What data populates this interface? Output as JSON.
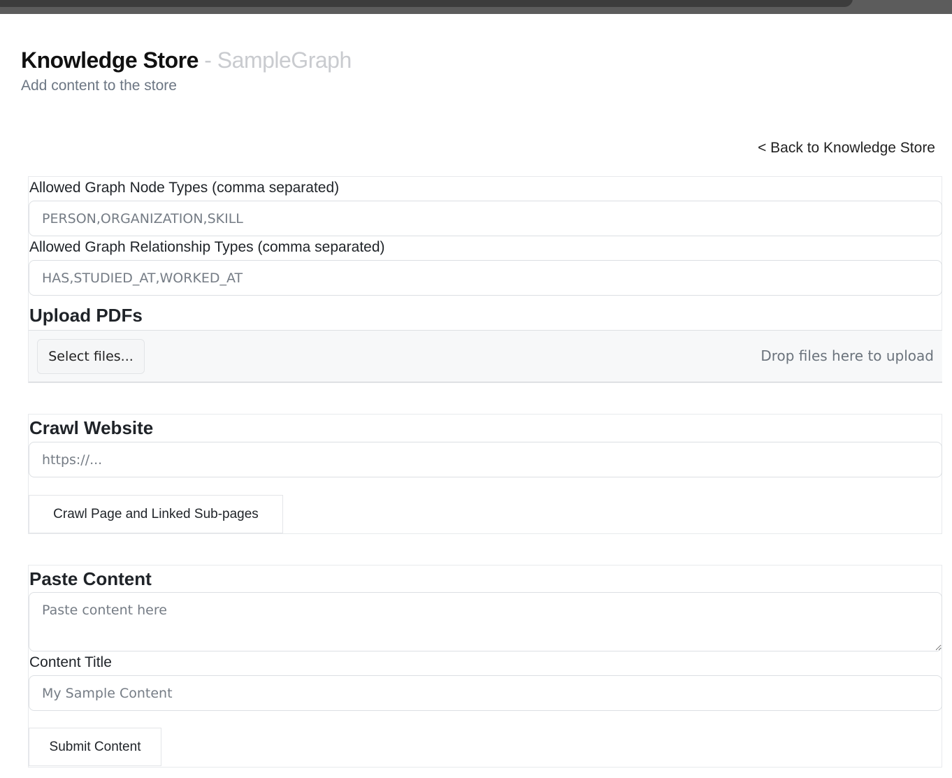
{
  "header": {
    "title": "Knowledge Store",
    "separator": "-",
    "graph_name": "SampleGraph",
    "subtitle": "Add content to the store"
  },
  "nav": {
    "back_link": "< Back to Knowledge Store"
  },
  "graph_settings": {
    "node_types_label": "Allowed Graph Node Types (comma separated)",
    "node_types_placeholder": "PERSON,ORGANIZATION,SKILL",
    "relationship_types_label": "Allowed Graph Relationship Types (comma separated)",
    "relationship_types_placeholder": "HAS,STUDIED_AT,WORKED_AT"
  },
  "upload": {
    "title": "Upload PDFs",
    "select_button": "Select files...",
    "drop_hint": "Drop files here to upload"
  },
  "crawl": {
    "title": "Crawl Website",
    "url_placeholder": "https://...",
    "button": "Crawl Page and Linked Sub-pages"
  },
  "paste": {
    "title": "Paste Content",
    "content_placeholder": "Paste content here",
    "content_title_label": "Content Title",
    "content_title_placeholder": "My Sample Content",
    "submit_button": "Submit Content"
  }
}
